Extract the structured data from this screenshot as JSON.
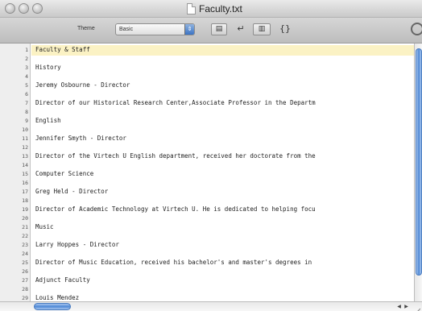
{
  "window": {
    "title": "Faculty.txt"
  },
  "toolbar": {
    "theme_label": "Theme",
    "theme_value": "Basic",
    "braces_label": "{}",
    "return_glyph": "↵"
  },
  "editor": {
    "lines": [
      {
        "num": "1",
        "text": "Faculty & Staff"
      },
      {
        "num": "2",
        "text": ""
      },
      {
        "num": "3",
        "text": "History"
      },
      {
        "num": "4",
        "text": ""
      },
      {
        "num": "5",
        "text": "Jeremy Osbourne - Director"
      },
      {
        "num": "6",
        "text": ""
      },
      {
        "num": "7",
        "text": "Director of our Historical Research Center,Associate Professor in the Departm"
      },
      {
        "num": "8",
        "text": ""
      },
      {
        "num": "9",
        "text": "English"
      },
      {
        "num": "10",
        "text": ""
      },
      {
        "num": "11",
        "text": "Jennifer Smyth - Director"
      },
      {
        "num": "12",
        "text": ""
      },
      {
        "num": "13",
        "text": "Director of the Virtech U English department, received her doctorate from the"
      },
      {
        "num": "14",
        "text": ""
      },
      {
        "num": "15",
        "text": "Computer Science"
      },
      {
        "num": "16",
        "text": ""
      },
      {
        "num": "17",
        "text": "Greg Held - Director"
      },
      {
        "num": "18",
        "text": ""
      },
      {
        "num": "19",
        "text": "Director of Academic Technology at Virtech U. He is dedicated to helping focu"
      },
      {
        "num": "20",
        "text": ""
      },
      {
        "num": "21",
        "text": "Music"
      },
      {
        "num": "22",
        "text": ""
      },
      {
        "num": "23",
        "text": "Larry Hoppes - Director"
      },
      {
        "num": "24",
        "text": ""
      },
      {
        "num": "25",
        "text": "Director of Music Education, received his bachelor's and master's degrees in"
      },
      {
        "num": "26",
        "text": ""
      },
      {
        "num": "27",
        "text": "Adjunct Faculty"
      },
      {
        "num": "28",
        "text": ""
      },
      {
        "num": "29",
        "text": "Louis Mendez"
      }
    ]
  }
}
